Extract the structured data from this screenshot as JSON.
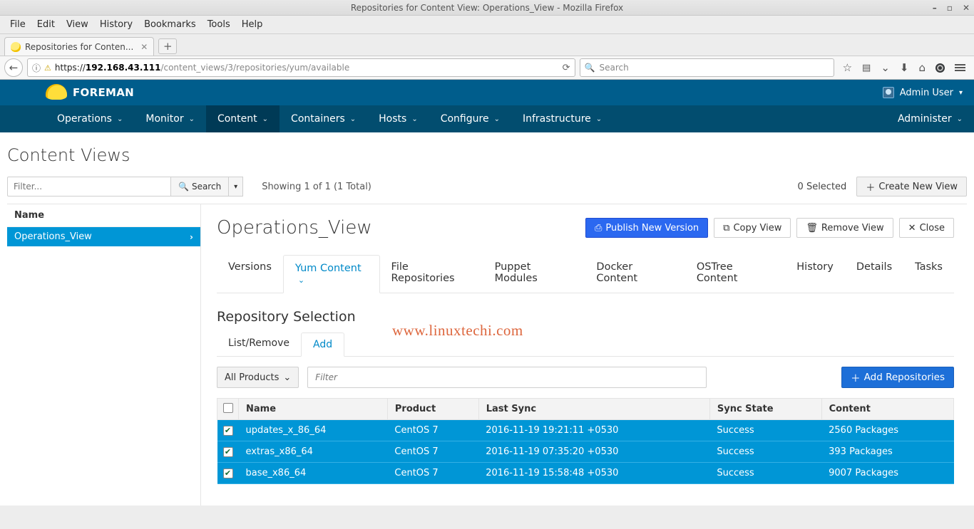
{
  "window": {
    "title": "Repositories for Content View: Operations_View - Mozilla Firefox"
  },
  "menubar": [
    "File",
    "Edit",
    "View",
    "History",
    "Bookmarks",
    "Tools",
    "Help"
  ],
  "browser_tab": {
    "label": "Repositories for Conten..."
  },
  "url": {
    "scheme": "https://",
    "host_bold": "192.168.43.111",
    "path": "/content_views/3/repositories/yum/available"
  },
  "searchbox": {
    "placeholder": "Search"
  },
  "brand": "FOREMAN",
  "user": {
    "name": "Admin User"
  },
  "nav": {
    "items": [
      "Operations",
      "Monitor",
      "Content",
      "Containers",
      "Hosts",
      "Configure",
      "Infrastructure"
    ],
    "active_index": 2,
    "right": "Administer"
  },
  "page": {
    "title": "Content Views",
    "filter_placeholder": "Filter...",
    "search_btn": "Search",
    "status": "Showing 1 of 1 (1 Total)",
    "selected": "0 Selected",
    "create_btn": "Create New View"
  },
  "side": {
    "header": "Name",
    "item": "Operations_View"
  },
  "cv": {
    "title": "Operations_View",
    "buttons": {
      "publish": "Publish New Version",
      "copy": "Copy View",
      "remove": "Remove View",
      "close": "Close"
    },
    "tabs": [
      "Versions",
      "Yum Content",
      "File Repositories",
      "Puppet Modules",
      "Docker Content",
      "OSTree Content",
      "History",
      "Details",
      "Tasks"
    ],
    "active_tab_index": 1
  },
  "repo_section": {
    "title": "Repository Selection",
    "subtabs": [
      "List/Remove",
      "Add"
    ],
    "active_subtab_index": 1,
    "product_dd": "All Products",
    "filter_placeholder": "Filter",
    "add_btn": "Add Repositories",
    "columns": [
      "Name",
      "Product",
      "Last Sync",
      "Sync State",
      "Content"
    ],
    "rows": [
      {
        "name": "updates_x_86_64",
        "product": "CentOS 7",
        "last_sync": "2016-11-19 19:21:11 +0530",
        "state": "Success",
        "content": "2560 Packages"
      },
      {
        "name": "extras_x86_64",
        "product": "CentOS 7",
        "last_sync": "2016-11-19 07:35:20 +0530",
        "state": "Success",
        "content": "393 Packages"
      },
      {
        "name": "base_x86_64",
        "product": "CentOS 7",
        "last_sync": "2016-11-19 15:58:48 +0530",
        "state": "Success",
        "content": "9007 Packages"
      }
    ]
  },
  "watermark": "www.linuxtechi.com"
}
